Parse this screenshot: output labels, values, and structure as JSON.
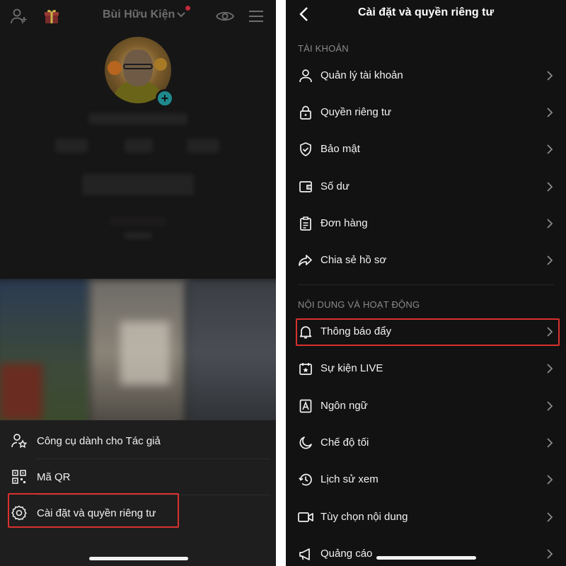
{
  "left": {
    "username": "Bùi Hữu Kiện",
    "icons": {
      "add_user": "add-user-icon",
      "gift": "gift-icon",
      "dropdown": "chevron-down-icon",
      "eye": "eye-icon",
      "menu": "hamburger-menu-icon",
      "avatar_add": "plus-icon"
    },
    "sheet": {
      "items": [
        {
          "label": "Công cụ dành cho Tác giả",
          "icon": "creator-tools-icon"
        },
        {
          "label": "Mã QR",
          "icon": "qr-code-icon"
        },
        {
          "label": "Cài đặt và quyền riêng tư",
          "icon": "settings-gear-icon"
        }
      ]
    }
  },
  "right": {
    "title": "Cài đặt và quyền riêng tư",
    "sections": [
      {
        "header": "TÀI KHOẢN",
        "items": [
          {
            "label": "Quản lý tài khoản",
            "icon": "person-icon"
          },
          {
            "label": "Quyền riêng tư",
            "icon": "lock-icon"
          },
          {
            "label": "Bảo mật",
            "icon": "shield-check-icon"
          },
          {
            "label": "Số dư",
            "icon": "wallet-icon"
          },
          {
            "label": "Đơn hàng",
            "icon": "order-list-icon"
          },
          {
            "label": "Chia sẻ hồ sơ",
            "icon": "share-arrow-icon"
          }
        ]
      },
      {
        "header": "NỘI DUNG VÀ HOẠT ĐỘNG",
        "items": [
          {
            "label": "Thông báo đẩy",
            "icon": "bell-icon"
          },
          {
            "label": "Sự kiện LIVE",
            "icon": "calendar-star-icon"
          },
          {
            "label": "Ngôn ngữ",
            "icon": "language-a-icon"
          },
          {
            "label": "Chế độ tối",
            "icon": "moon-icon"
          },
          {
            "label": "Lịch sử xem",
            "icon": "history-icon"
          },
          {
            "label": "Tùy chọn nội dung",
            "icon": "video-camera-icon"
          },
          {
            "label": "Quảng cáo",
            "icon": "megaphone-icon"
          }
        ]
      }
    ]
  },
  "highlight_color": "#d9312f"
}
